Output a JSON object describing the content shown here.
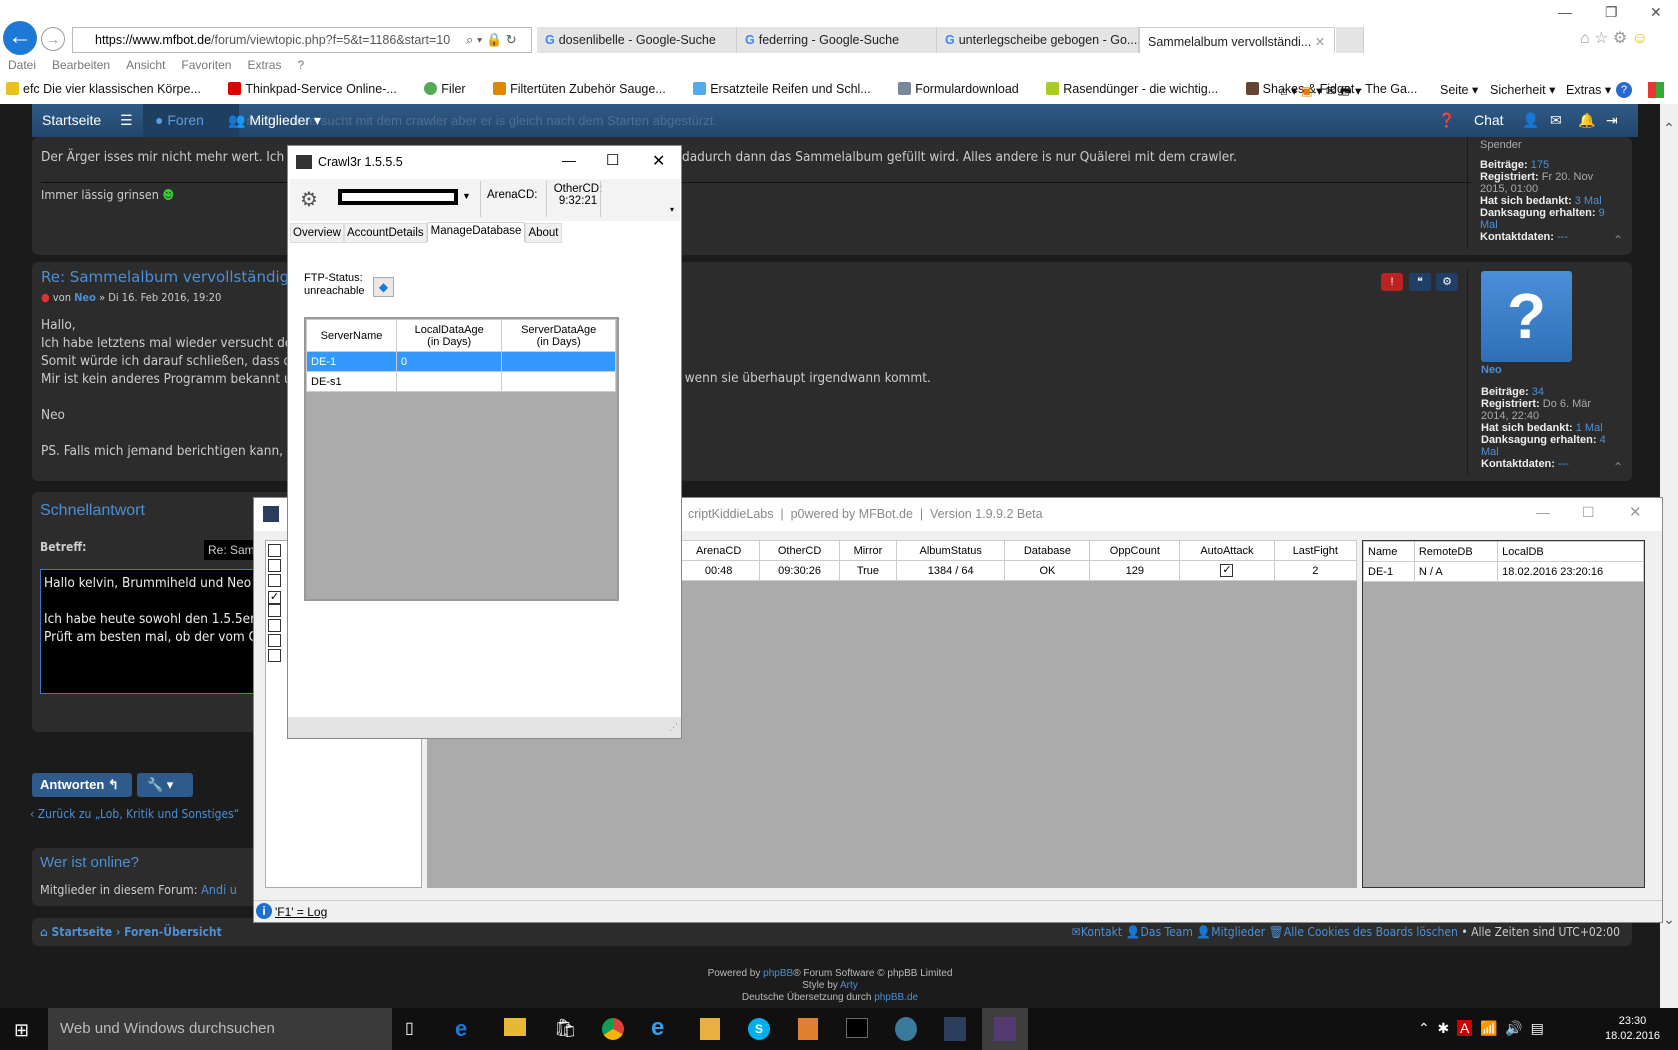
{
  "browser": {
    "url_host": "https://www.mfbot.de",
    "url_path": "/forum/viewtopic.php?f=5&t=1186&start=10",
    "tabs": [
      {
        "label": "dosenlibelle - Google-Suche"
      },
      {
        "label": "federring - Google-Suche"
      },
      {
        "label": "unterlegscheibe gebogen - Go..."
      },
      {
        "label": "Sammelalbum vervollständi...",
        "active": true
      }
    ],
    "menu": [
      "Datei",
      "Bearbeiten",
      "Ansicht",
      "Favoriten",
      "Extras",
      "?"
    ],
    "favorites": [
      "efc Die vier klassischen Körpe...",
      "Thinkpad-Service Online-...",
      "Filer",
      "Filtertüten Zubehör Sauge...",
      "Ersatzteile Reifen und Schl...",
      "Formulardownload",
      "Rasendünger - die wichtig...",
      "Shakes & Fidget - The Ga..."
    ],
    "commands": [
      "Seite",
      "Sicherheit",
      "Extras"
    ]
  },
  "forum": {
    "nav": {
      "home": "Startseite",
      "forums": "Foren",
      "members": "Mitglieder",
      "chat": "Chat",
      "overlay_text": "ich die Tage auch noch mal versucht mit dem crawler aber er is gleich nach dem Starten abgestürzt."
    },
    "post1": {
      "line1_start": "Der Ärger isses mir nicht mehr wert. Ich h",
      "line1_end": "dadurch dann das Sammelalbum gefüllt wird. Alles andere is nur Quälerei mit dem crawler.",
      "signature": "Immer lässig grinsen",
      "profile": {
        "rank": "Spender",
        "posts_label": "Beiträge:",
        "posts": "175",
        "reg_label": "Registriert:",
        "reg": "Fr 20. Nov 2015, 01:00",
        "thanked_label": "Hat sich bedankt:",
        "thanked": "3 Mal",
        "received_label": "Danksagung erhalten:",
        "received": "9 Mal",
        "contact_label": "Kontaktdaten:",
        "contact": "---"
      }
    },
    "post2": {
      "title": "Re: Sammelalbum vervollständigen?",
      "by": "von",
      "author": "Neo",
      "date": "» Di 16. Feb 2016, 19:20",
      "lines": [
        "Hallo,",
        "Ich habe letztens mal wieder versucht der",
        "Somit würde ich darauf schließen, dass de",
        "Mir ist kein anderes Programm bekannt un",
        "Neo",
        "PS. Falls mich jemand berichtigen kann, w"
      ],
      "line_end": ", wenn sie überhaupt irgendwann kommt.",
      "profile": {
        "name": "Neo",
        "posts_label": "Beiträge:",
        "posts": "34",
        "reg_label": "Registriert:",
        "reg": "Do 6. Mär 2014, 22:40",
        "thanked_label": "Hat sich bedankt:",
        "thanked": "1 Mal",
        "received_label": "Danksagung erhalten:",
        "received": "4 Mal",
        "contact_label": "Kontaktdaten:",
        "contact": "---"
      }
    },
    "quickreply": {
      "title": "Schnellantwort",
      "subject_label": "Betreff:",
      "subject_value": "Re: Sam",
      "body": [
        "Hallo kelvin, Brummiheld und Neo!",
        "",
        "Ich habe heute sowohl den 1.5.5er,",
        "Prüft am besten mal, ob der vom C"
      ]
    },
    "reply_button": "Antworten",
    "back_link": "Zurück zu „Lob, Kritik und Sonstiges“",
    "online": {
      "title": "Wer ist online?",
      "text": "Mitglieder in diesem Forum:",
      "user": "Andi u"
    },
    "breadcrumb": {
      "home": "Startseite",
      "index": "Foren-Übersicht"
    },
    "footer_links": [
      "Kontakt",
      "Das Team",
      "Mitglieder",
      "Alle Cookies des Boards löschen"
    ],
    "timezone": "• Alle Zeiten sind UTC+02:00",
    "footer": {
      "powered_a": "Powered by",
      "phpbb": "phpBB",
      "powered_b": "® Forum Software © phpBB Limited",
      "style_by": "Style by",
      "arty": "Arty",
      "translation": "Deutsche Übersetzung durch",
      "phpbbde": "phpBB.de"
    }
  },
  "crawler": {
    "title": "Crawl3r 1.5.5.5",
    "arena_label": "ArenaCD:",
    "other_label": "OtherCD:",
    "other_value": "9:32:21",
    "tabs": [
      "Overview",
      "AccountDetails",
      "ManageDatabase",
      "About"
    ],
    "active_tab": "ManageDatabase",
    "ftp_label": "FTP-Status:",
    "ftp_value": "unreachable",
    "columns": [
      "ServerName",
      "LocalDataAge\n(in Days)",
      "ServerDataAge\n(in Days)"
    ],
    "rows": [
      [
        "DE-1",
        "0",
        ""
      ],
      [
        "DE-s1",
        "",
        ""
      ]
    ]
  },
  "mfbot": {
    "title_text": "criptKiddieLabs  |  p0wered by MFBot.de  |  Version 1.9.9.2 Beta",
    "columns": [
      "ArenaCD",
      "OtherCD",
      "Mirror",
      "AlbumStatus",
      "Database",
      "OppCount",
      "AutoAttack",
      "LastFight"
    ],
    "row": [
      "00:48",
      "09:30:26",
      "True",
      "1384 / 64",
      "OK",
      "129",
      "checked",
      "2"
    ],
    "db_columns": [
      "Name",
      "RemoteDB",
      "LocalDB"
    ],
    "db_row": [
      "DE-1",
      "N / A",
      "18.02.2016 23:20:16"
    ],
    "checkboxes": [
      false,
      false,
      false,
      true,
      false,
      false,
      false,
      false
    ],
    "status": "'F1' = Log"
  },
  "taskbar": {
    "search": "Web und Windows durchsuchen",
    "time": "23:30",
    "date": "18.02.2016"
  }
}
